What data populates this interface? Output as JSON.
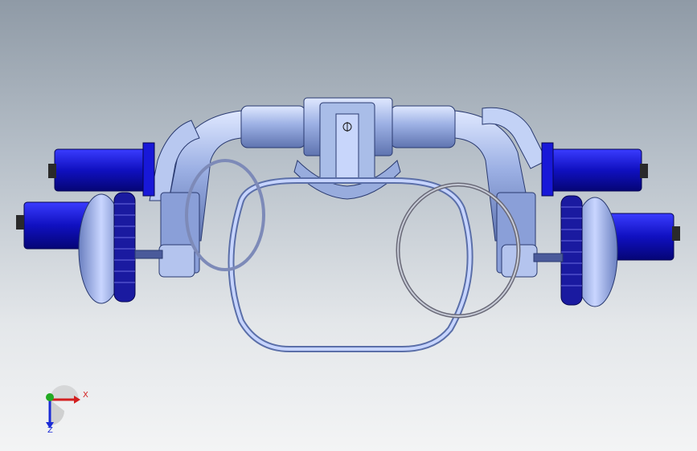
{
  "viewport": {
    "background_top": "#8f9aa6",
    "background_bottom": "#f3f4f5"
  },
  "model": {
    "primary_color": "#1414c8",
    "frame_color": "#9fb3e6",
    "outline_color": "#2a3a70"
  },
  "triad": {
    "x_label": "X",
    "z_label": "Z",
    "x_color": "#d21f1f",
    "y_color": "#22aa22",
    "z_color": "#1a2bd6"
  }
}
